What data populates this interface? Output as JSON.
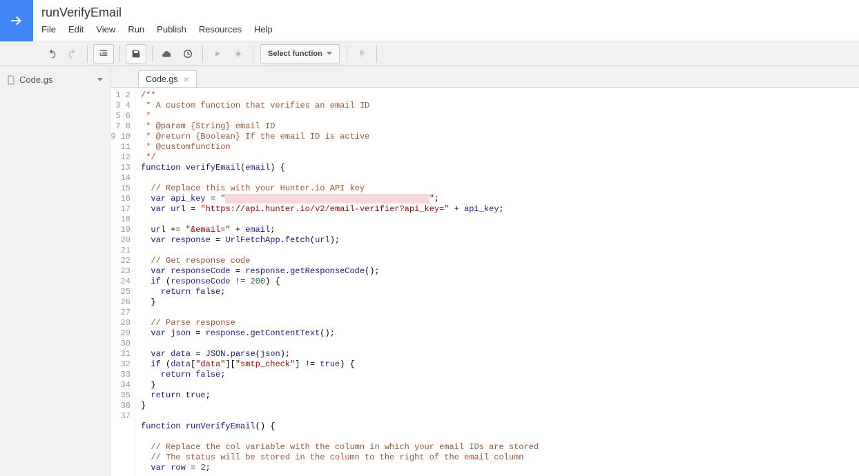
{
  "project_title": "runVerifyEmail",
  "menu": [
    "File",
    "Edit",
    "View",
    "Run",
    "Publish",
    "Resources",
    "Help"
  ],
  "toolbar": {
    "select_function": "Select function"
  },
  "sidebar": {
    "file": "Code.gs"
  },
  "tab": {
    "label": "Code.gs"
  },
  "code": {
    "lines": 37,
    "l1": "/**",
    "l2": " * A custom function that verifies an email ID",
    "l3": " *",
    "l4_a": " * @param {String} email ID",
    "l5_a": " * @return {Boolean} If the email ID is active",
    "l6_a": " * @customfunction",
    "l7": " */",
    "l8_fn": "function ",
    "l8_name": "verifyEmail",
    "l8_par_open": "(",
    "l8_arg": "email",
    "l8_rest": ") {",
    "l10": "  // Replace this with your Hunter.io API key",
    "l11_pre": "  var ",
    "l11_var": "api_key",
    "l11_eq": " = ",
    "l11_str_open": "\"",
    "l11_redacted": "                                         ",
    "l11_str_close": "\"",
    "l11_end": ";",
    "l12_pre": "  var ",
    "l12_var": "url",
    "l12_eq": " = ",
    "l12_str": "\"https://api.hunter.io/v2/email-verifier?api_key=\"",
    "l12_plus": " + ",
    "l12_ak": "api_key",
    "l12_end": ";",
    "l14_pre": "  ",
    "l14_var": "url",
    "l14_op": " += ",
    "l14_str": "\"&email=\"",
    "l14_plus": " + ",
    "l14_em": "email",
    "l14_end": ";",
    "l15_pre": "  var ",
    "l15_var": "response",
    "l15_eq": " = ",
    "l15_obj": "UrlFetchApp",
    "l15_dot": ".",
    "l15_m": "fetch",
    "l15_open": "(",
    "l15_arg": "url",
    "l15_close": ");",
    "l17": "  // Get response code",
    "l18_pre": "  var ",
    "l18_var": "responseCode",
    "l18_eq": " = ",
    "l18_obj": "response",
    "l18_dot": ".",
    "l18_m": "getResponseCode",
    "l18_end": "();",
    "l19_if": "  if ",
    "l19_open": "(",
    "l19_var": "responseCode",
    "l19_op": " != ",
    "l19_num": "200",
    "l19_close": ") {",
    "l20_ret": "    return ",
    "l20_false": "false",
    "l20_end": ";",
    "l21": "  }",
    "l23": "  // Parse response",
    "l24_pre": "  var ",
    "l24_var": "json",
    "l24_eq": " = ",
    "l24_obj": "response",
    "l24_dot": ".",
    "l24_m": "getContentText",
    "l24_end": "();",
    "l26_pre": "  var ",
    "l26_var": "data",
    "l26_eq": " = ",
    "l26_obj": "JSON",
    "l26_dot": ".",
    "l26_m": "parse",
    "l26_open": "(",
    "l26_arg": "json",
    "l26_close": ");",
    "l27_if": "  if ",
    "l27_open": "(",
    "l27_var": "data",
    "l27_br1": "[",
    "l27_s1": "\"data\"",
    "l27_br2": "][",
    "l27_s2": "\"smtp_check\"",
    "l27_br3": "]",
    "l27_op": " != ",
    "l27_true": "true",
    "l27_close": ") {",
    "l28_ret": "    return ",
    "l28_false": "false",
    "l28_end": ";",
    "l29": "  }",
    "l30_ret": "  return ",
    "l30_true": "true",
    "l30_end": ";",
    "l31": "}",
    "l33_fn": "function ",
    "l33_name": "runVerifyEmail",
    "l33_rest": "() {",
    "l35": "  // Replace the col variable with the column in which your email IDs are stored",
    "l36": "  // The status will be stored in the column to the right of the email column",
    "l37_pre": "  var ",
    "l37_var": "row",
    "l37_eq": " = ",
    "l37_num": "2",
    "l37_end": ";"
  }
}
